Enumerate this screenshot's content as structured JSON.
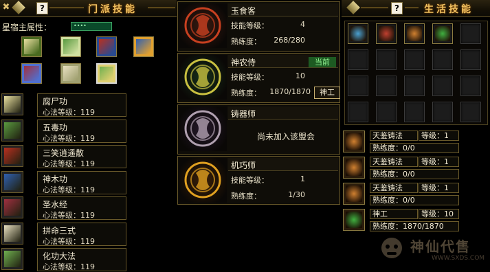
{
  "left": {
    "title": "门派技能",
    "help": "?",
    "attribute_label": "星宿主属性：",
    "attribute_value": "••••",
    "books": [
      {
        "color": "#e9e0a0",
        "accent": "#4a6a20"
      },
      {
        "color": "#5a9a40",
        "accent": "#d0e0a0"
      },
      {
        "color": "#b83020",
        "accent": "#2a4a90"
      },
      {
        "color": "#3060b0",
        "accent": "#e0a030"
      },
      {
        "color": "#a03040",
        "accent": "#5070d0"
      },
      {
        "color": "#e8e0c0",
        "accent": "#a0a070"
      },
      {
        "color": "#70b050",
        "accent": "#e0d070"
      }
    ],
    "skills": [
      {
        "name": "腐尸功",
        "level": "心法等级：119",
        "color": "#e9e0a0"
      },
      {
        "name": "五毒功",
        "level": "心法等级：119",
        "color": "#5a9a40"
      },
      {
        "name": "三笑逍遥散",
        "level": "心法等级：119",
        "color": "#b83020"
      },
      {
        "name": "神木功",
        "level": "心法等级：119",
        "color": "#3060b0"
      },
      {
        "name": "圣水经",
        "level": "心法等级：119",
        "color": "#a03040"
      },
      {
        "name": "拼命三式",
        "level": "心法等级：119",
        "color": "#e8e0c0"
      },
      {
        "name": "化功大法",
        "level": "心法等级：119",
        "color": "#70b050"
      }
    ]
  },
  "center": {
    "professions": [
      {
        "title": "玉食客",
        "l1": "技能等级：",
        "v1": "4",
        "l2": "熟练度：",
        "v2": "268/280",
        "bg": "#3a1a10",
        "emblem": "#c84020"
      },
      {
        "title": "神农侍",
        "l1": "技能等级：",
        "v1": "10",
        "l2": "熟练度：",
        "v2": "1870/1870",
        "tag": "当前",
        "btn": "神工",
        "bg": "#17301a",
        "emblem": "#c8c040"
      },
      {
        "title": "铸器师",
        "notice": "尚未加入该盟会",
        "bg": "#25182a",
        "emblem": "#b0a0b0"
      },
      {
        "title": "机巧师",
        "l1": "技能等级：",
        "v1": "1",
        "l2": "熟练度：",
        "v2": "1/30",
        "bg": "#3a2008",
        "emblem": "#e0a020"
      }
    ]
  },
  "right": {
    "title": "生活技能",
    "help": "?",
    "filled_slots": [
      {
        "color": "#4aa0d0"
      },
      {
        "color": "#c04030"
      },
      {
        "color": "#d08030"
      },
      {
        "color": "#40b040"
      }
    ],
    "recipes": [
      {
        "name": "天鉴铸法",
        "level": "等级：1",
        "prof": "熟练度：0/0"
      },
      {
        "name": "天鉴铸法",
        "level": "等级：1",
        "prof": "熟练度：0/0"
      },
      {
        "name": "天鉴铸法",
        "level": "等级：1",
        "prof": "熟练度：0/0"
      },
      {
        "name": "神工",
        "level": "等级：10",
        "prof": "熟练度：1870/1870"
      }
    ],
    "watermark": "神仙代售",
    "watermark_url": "WWW.SXDS.COM"
  }
}
